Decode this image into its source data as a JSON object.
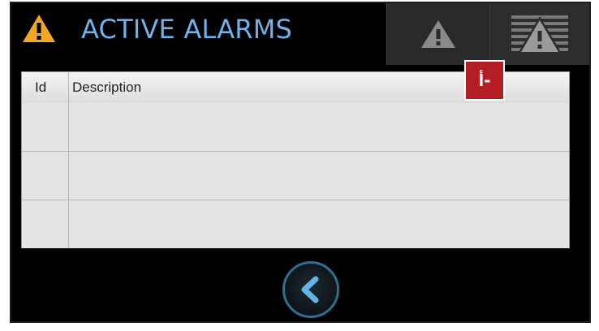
{
  "header": {
    "title": "ACTIVE ALARMS",
    "warning_icon": "warning-triangle-icon",
    "accent_color": "#6fb2ea",
    "warning_color": "#f5a623"
  },
  "toolbar": {
    "buttons": [
      {
        "icon": "warning-triangle-icon"
      },
      {
        "icon": "alarm-history-icon"
      }
    ]
  },
  "table": {
    "columns": [
      "Id",
      "Description"
    ],
    "rows": [
      {
        "id": "",
        "description": ""
      },
      {
        "id": "",
        "description": ""
      },
      {
        "id": "",
        "description": ""
      }
    ]
  },
  "annotation": {
    "label": "أ-",
    "color": "#b21e24"
  },
  "footer": {
    "back_icon": "chevron-left-icon"
  }
}
